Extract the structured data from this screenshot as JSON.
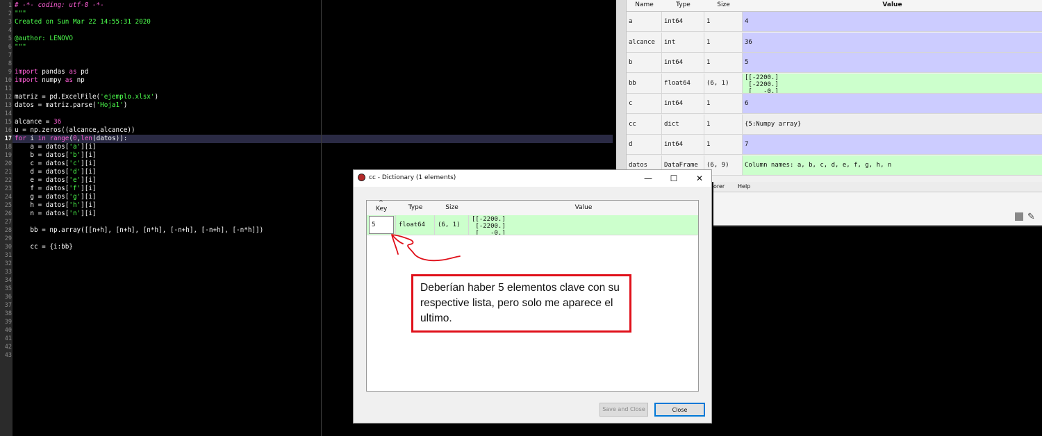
{
  "editor": {
    "lines": [
      {
        "n": "1",
        "html": "<span class=\"cm\"># -*- coding: utf-8 -*-</span>"
      },
      {
        "n": "2",
        "html": "<span class=\"gr\">\"\"\"</span>"
      },
      {
        "n": "3",
        "html": "<span class=\"gr\">Created on Sun Mar 22 14:55:31 2020</span>"
      },
      {
        "n": "4",
        "html": ""
      },
      {
        "n": "5",
        "html": "<span class=\"gr\">@author: LENOVO</span>"
      },
      {
        "n": "6",
        "html": "<span class=\"gr\">\"\"\"</span>"
      },
      {
        "n": "7",
        "html": ""
      },
      {
        "n": "8",
        "html": ""
      },
      {
        "n": "9",
        "html": "<span class=\"kw\">import</span> pandas <span class=\"kw\">as</span> pd"
      },
      {
        "n": "10",
        "html": "<span class=\"kw\">import</span> numpy <span class=\"kw\">as</span> np"
      },
      {
        "n": "11",
        "html": ""
      },
      {
        "n": "12",
        "html": "matriz = pd.ExcelFile(<span class=\"st\">'ejemplo.xlsx'</span>)"
      },
      {
        "n": "13",
        "html": "datos = matriz.parse(<span class=\"st\">'Hoja1'</span>)"
      },
      {
        "n": "14",
        "html": ""
      },
      {
        "n": "15",
        "html": "alcance = <span class=\"nm\">36</span>"
      },
      {
        "n": "16",
        "html": "u = np.zeros((alcance,alcance))"
      },
      {
        "n": "17",
        "html": "<span class=\"kw\">for</span> i <span class=\"kw\">in</span> <span class=\"kw\">range</span>(<span class=\"nm\">0</span>,<span class=\"kw\">len</span>(datos)):"
      },
      {
        "n": "18",
        "html": "    a = datos[<span class=\"st\">'a'</span>][i]"
      },
      {
        "n": "19",
        "html": "    b = datos[<span class=\"st\">'b'</span>][i]"
      },
      {
        "n": "20",
        "html": "    c = datos[<span class=\"st\">'c'</span>][i]"
      },
      {
        "n": "21",
        "html": "    d = datos[<span class=\"st\">'d'</span>][i]"
      },
      {
        "n": "22",
        "html": "    e = datos[<span class=\"st\">'e'</span>][i]"
      },
      {
        "n": "23",
        "html": "    f = datos[<span class=\"st\">'f'</span>][i]"
      },
      {
        "n": "24",
        "html": "    g = datos[<span class=\"st\">'g'</span>][i]"
      },
      {
        "n": "25",
        "html": "    h = datos[<span class=\"st\">'h'</span>][i]"
      },
      {
        "n": "26",
        "html": "    n = datos[<span class=\"st\">'n'</span>][i]"
      },
      {
        "n": "27",
        "html": ""
      },
      {
        "n": "28",
        "html": "    bb = np.array([[n+h], [n+h], [n*h], [-n+h], [-n+h], [-n*h]])"
      },
      {
        "n": "29",
        "html": ""
      },
      {
        "n": "30",
        "html": "    cc = {i:bb}"
      },
      {
        "n": "31",
        "html": ""
      },
      {
        "n": "32",
        "html": ""
      },
      {
        "n": "33",
        "html": ""
      },
      {
        "n": "34",
        "html": ""
      },
      {
        "n": "35",
        "html": ""
      },
      {
        "n": "36",
        "html": ""
      },
      {
        "n": "37",
        "html": ""
      },
      {
        "n": "38",
        "html": ""
      },
      {
        "n": "39",
        "html": ""
      },
      {
        "n": "40",
        "html": ""
      },
      {
        "n": "41",
        "html": ""
      },
      {
        "n": "42",
        "html": ""
      },
      {
        "n": "43",
        "html": ""
      }
    ],
    "current_line": "17"
  },
  "variable_explorer": {
    "headers": {
      "name": "Name",
      "type": "Type",
      "size": "Size",
      "value": "Value"
    },
    "rows": [
      {
        "name": "a",
        "type": "int64",
        "size": "1",
        "value": "4",
        "color": "#ccccff"
      },
      {
        "name": "alcance",
        "type": "int",
        "size": "1",
        "value": "36",
        "color": "#ccccff"
      },
      {
        "name": "b",
        "type": "int64",
        "size": "1",
        "value": "5",
        "color": "#ccccff"
      },
      {
        "name": "bb",
        "type": "float64",
        "size": "(6, 1)",
        "value": "[[-2200.]\n [-2200.]\n [   -0.]",
        "color": "#ccffcc"
      },
      {
        "name": "c",
        "type": "int64",
        "size": "1",
        "value": "6",
        "color": "#ccccff"
      },
      {
        "name": "cc",
        "type": "dict",
        "size": "1",
        "value": "{5:Numpy array}",
        "color": "#eeeeee"
      },
      {
        "name": "d",
        "type": "int64",
        "size": "1",
        "value": "7",
        "color": "#ccccff"
      },
      {
        "name": "datos",
        "type": "DataFrame",
        "size": "(6, 9)",
        "value": "Column names: a, b, c, d, e, f, g, h, n",
        "color": "#ccffcc"
      }
    ]
  },
  "right_pane": {
    "tab_explorer": "orer",
    "tab_help": "Help"
  },
  "dialog": {
    "title": "cc - Dictionary (1 elements)",
    "window_buttons": {
      "minimize": "—",
      "maximize": "☐",
      "close": "✕"
    },
    "headers": {
      "key": "Key",
      "type": "Type",
      "size": "Size",
      "value": "Value"
    },
    "sort_arrow": "^",
    "row": {
      "key": "5",
      "type": "float64",
      "size": "(6, 1)",
      "value": "[[-2200.]\n [-2200.]\n [   -0.]"
    },
    "save_close_label": "Save and Close",
    "close_label": "Close"
  },
  "annotation": {
    "text": "Deberían haber 5 elementos clave con su respective lista, pero solo me aparece el ultimo.",
    "border_color": "#e0101a"
  }
}
